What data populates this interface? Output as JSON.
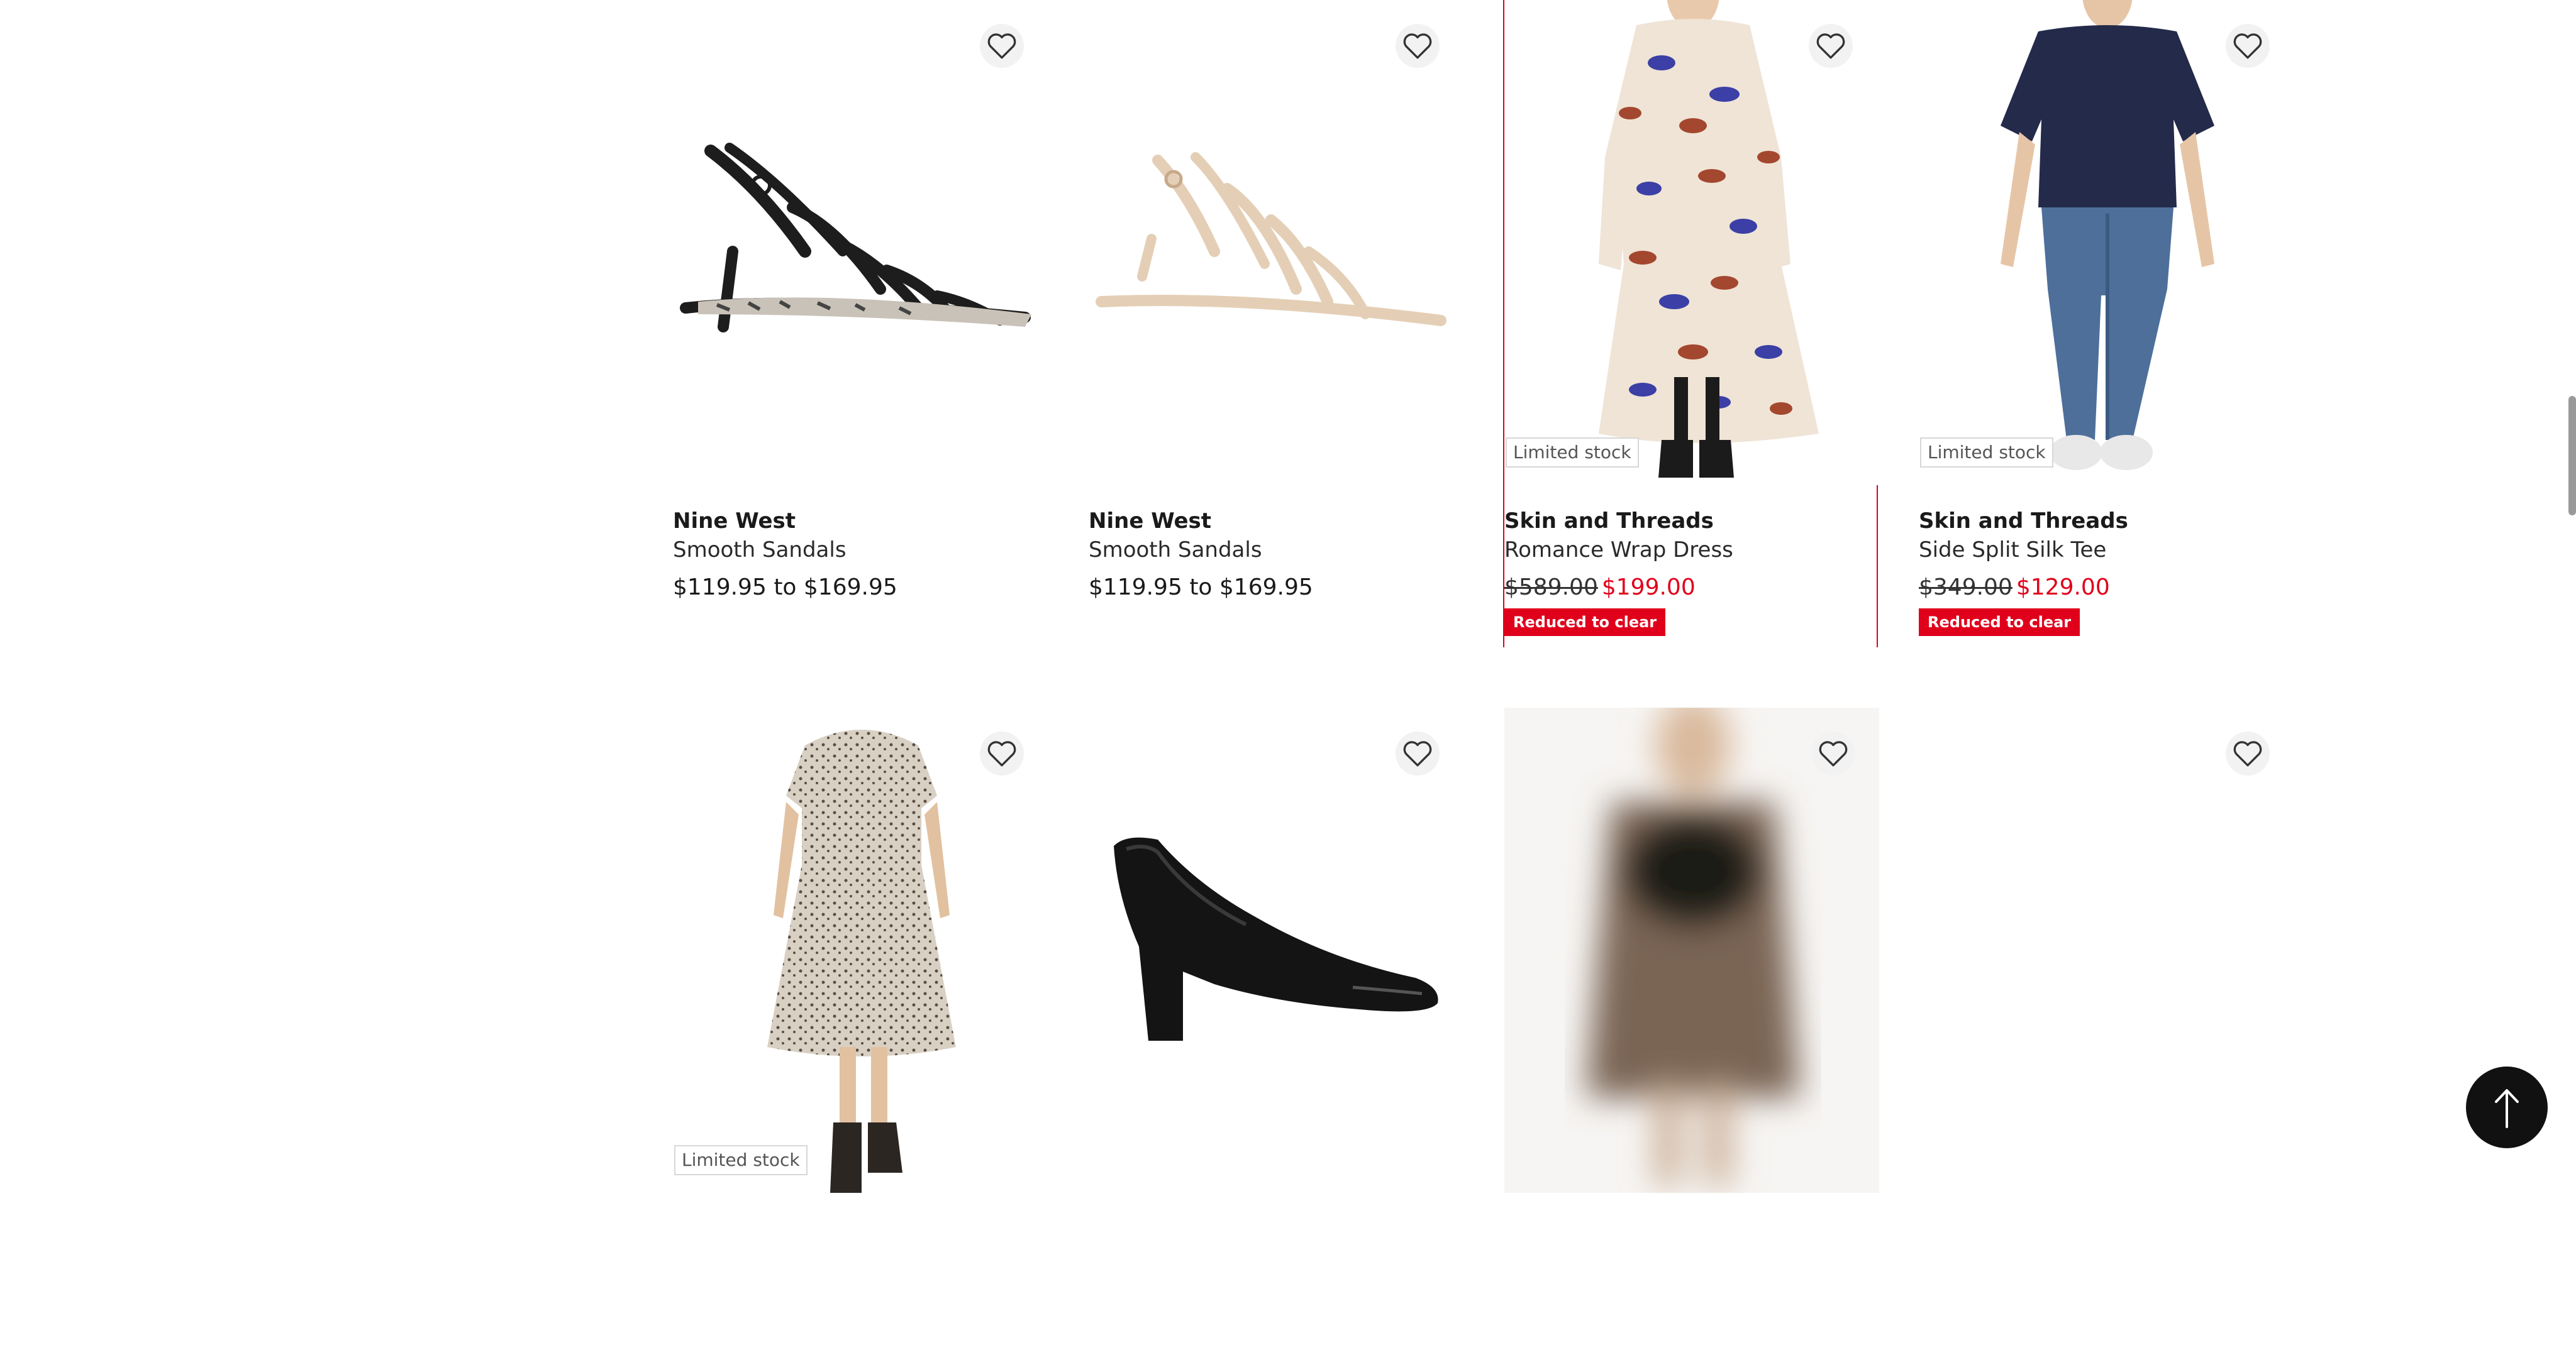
{
  "products": [
    {
      "brand": "Nine West",
      "name": "Smooth Sandals",
      "price_range": "$119.95 to $169.95",
      "favorite_icon": "heart-outline-icon"
    },
    {
      "brand": "Nine West",
      "name": "Smooth Sandals",
      "price_range": "$119.95 to $169.95",
      "favorite_icon": "heart-outline-icon"
    },
    {
      "brand": "Skin and Threads",
      "name": "Romance Wrap Dress",
      "badge": "Limited stock",
      "price_original": "$589.00",
      "price_sale": "$199.00",
      "promo": "Reduced to clear",
      "favorite_icon": "heart-outline-icon"
    },
    {
      "brand": "Skin and Threads",
      "name": "Side Split Silk Tee",
      "badge": "Limited stock",
      "price_original": "$349.00",
      "price_sale": "$129.00",
      "promo": "Reduced to clear",
      "favorite_icon": "heart-outline-icon"
    },
    {
      "badge": "Limited stock",
      "favorite_icon": "heart-outline-icon"
    },
    {
      "favorite_icon": "heart-outline-icon"
    },
    {
      "favorite_icon": "heart-outline-icon"
    },
    {
      "favorite_icon": "heart-outline-icon"
    }
  ],
  "back_to_top_icon": "arrow-up-icon",
  "colors": {
    "sale": "#e0001b",
    "highlight_border": "#e0001b",
    "back_to_top_bg": "#111111"
  }
}
